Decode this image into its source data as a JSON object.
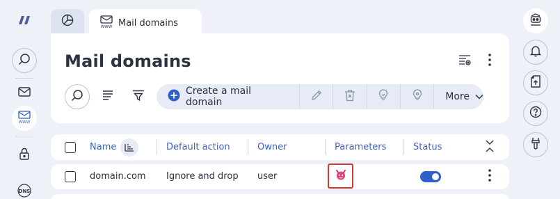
{
  "tabs": [
    {
      "icon": "dashboard-icon"
    },
    {
      "icon": "mail-domain-icon",
      "label": "Mail domains",
      "active": true
    }
  ],
  "page": {
    "title": "Mail domains"
  },
  "toolbar": {
    "create_label": "Create a mail domain",
    "more_label": "More"
  },
  "table": {
    "columns": [
      "Name",
      "Default action",
      "Owner",
      "Parameters",
      "Status"
    ],
    "rows": [
      {
        "name": "domain.com",
        "default_action": "Ignore and drop",
        "owner": "user",
        "status_enabled": true
      }
    ]
  },
  "left_rail": {
    "dns_label": "DNS",
    "items": [
      "logo-icon",
      "search-icon",
      "mail-icon",
      "mail-domain-icon",
      "lock-icon",
      "dns-icon"
    ]
  },
  "right_rail": {
    "items": [
      "robot-icon",
      "bell-icon",
      "file-upload-icon",
      "help-icon",
      "wrench-icon"
    ]
  },
  "colors": {
    "accent": "#2f5fc9",
    "highlight": "#d8342c",
    "background": "#eef1f8"
  }
}
